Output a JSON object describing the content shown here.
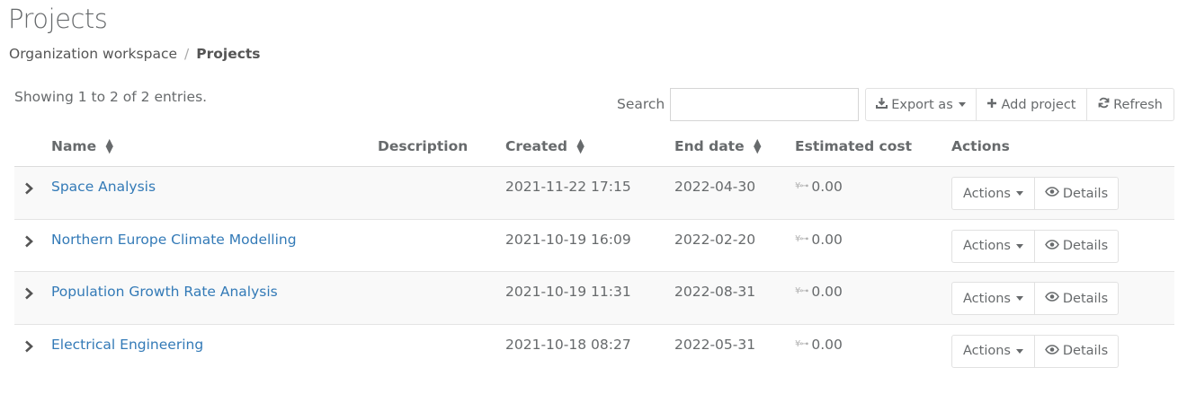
{
  "page": {
    "title": "Projects"
  },
  "breadcrumb": {
    "parent": "Organization workspace",
    "separator": "/",
    "current": "Projects"
  },
  "table_info": {
    "showing": "Showing 1 to 2 of 2 entries."
  },
  "search": {
    "label": "Search",
    "value": ""
  },
  "toolbar": {
    "export_label": "Export as",
    "add_label": "Add project",
    "refresh_label": "Refresh"
  },
  "columns": {
    "name": "Name",
    "description": "Description",
    "created": "Created",
    "end_date": "End date",
    "estimated_cost": "Estimated cost",
    "actions": "Actions"
  },
  "rows": [
    {
      "name": "Space Analysis",
      "description": "",
      "created": "2021-11-22 17:15",
      "end_date": "2022-04-30",
      "estimated_cost": "0.00",
      "actions_label": "Actions",
      "details_label": "Details"
    },
    {
      "name": "Northern Europe Climate Modelling",
      "description": "",
      "created": "2021-10-19 16:09",
      "end_date": "2022-02-20",
      "estimated_cost": "0.00",
      "actions_label": "Actions",
      "details_label": "Details"
    },
    {
      "name": "Population Growth Rate Analysis",
      "description": "",
      "created": "2021-10-19 11:31",
      "end_date": "2022-08-31",
      "estimated_cost": "0.00",
      "actions_label": "Actions",
      "details_label": "Details"
    },
    {
      "name": "Electrical Engineering",
      "description": "",
      "created": "2021-10-18 08:27",
      "end_date": "2022-05-31",
      "estimated_cost": "0.00",
      "actions_label": "Actions",
      "details_label": "Details"
    }
  ],
  "icons": {
    "export": "download-icon",
    "add": "plus-icon",
    "refresh": "refresh-icon",
    "details": "eye-icon",
    "expand": "chevron-right-icon",
    "sort": "sort-icon",
    "cost": "currency-icon"
  },
  "colors": {
    "link": "#337ab7",
    "text": "#676a6c",
    "row_stripe": "#f9f9f9"
  }
}
